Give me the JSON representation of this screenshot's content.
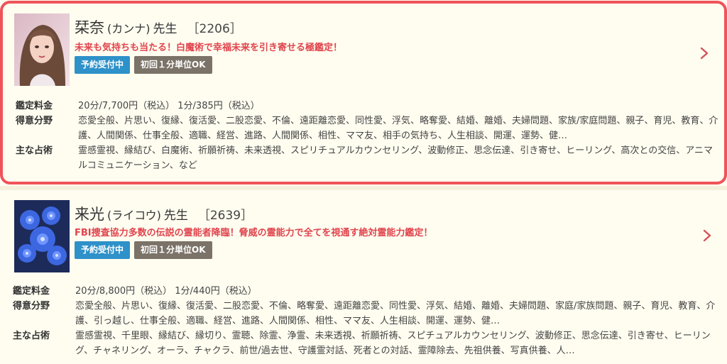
{
  "cards": [
    {
      "name": "栞奈",
      "kana": "(カンナ)",
      "sensei": "先生",
      "code": "［2206］",
      "catch": "未来も気持ちも当たる！白魔術で幸福未来を引き寄せる極鑑定！",
      "badges": [
        "予約受付中",
        "初回１分単位OK"
      ],
      "fee_label": "鑑定料金",
      "fee": "20分/7,700円（税込） 1分/385円（税込）",
      "fields_label": "得意分野",
      "fields": "恋愛全般、片思い、復縁、復活愛、二股恋愛、不倫、遠距離恋愛、同性愛、浮気、略奪愛、結婚、離婚、夫婦問題、家族/家庭問題、親子、育児、教育、介護、人間関係、仕事全般、適職、経営、進路、人間関係、相性、ママ友、相手の気持ち、人生相談、開運、運勢、健…",
      "methods_label": "主な占術",
      "methods": "霊感霊視、縁結び、白魔術、祈願祈祷、未来透視、スピリチュアルカウンセリング、波動修正、思念伝達、引き寄せ、ヒーリング、高次との交信、アニマルコミュニケーション、など"
    },
    {
      "name": "来光",
      "kana": "(ライコウ)",
      "sensei": "先生",
      "code": "［2639］",
      "catch": "FBI捜査協力多数の伝説の霊能者降臨！脅威の霊能力で全てを視通す絶対霊能力鑑定！",
      "badges": [
        "予約受付中",
        "初回１分単位OK"
      ],
      "fee_label": "鑑定料金",
      "fee": "20分/8,800円（税込） 1分/440円（税込）",
      "fields_label": "得意分野",
      "fields": "恋愛全般、片思い、復縁、復活愛、二股恋愛、不倫、略奪愛、遠距離恋愛、同性愛、浮気、結婚、離婚、夫婦問題、家庭/家族問題、親子、育児、教育、介護、引っ越し、仕事全般、適職、経営、進路、人間関係、相性、ママ友、人生相談、開運、運勢、健…",
      "methods_label": "主な占術",
      "methods": "霊感霊視、千里眼、縁結び、縁切り、霊聴、除霊、浄霊、未来透視、祈願祈祷、スピチュアルカウンセリング、波動修正、思念伝達、引き寄せ、ヒーリング、チャネリング、オーラ、チャクラ、前世/過去世、守護霊対話、死者との対話、霊障除去、先祖供養、写真供養、人…"
    }
  ],
  "colors": {
    "selected_border": "#f0535a",
    "catch_text": "#e0444d",
    "badge_reserve": "#2e91c9",
    "badge_first": "#7b7268",
    "chevron": "#d4535a"
  },
  "icons": [
    "chevron-right-icon"
  ]
}
